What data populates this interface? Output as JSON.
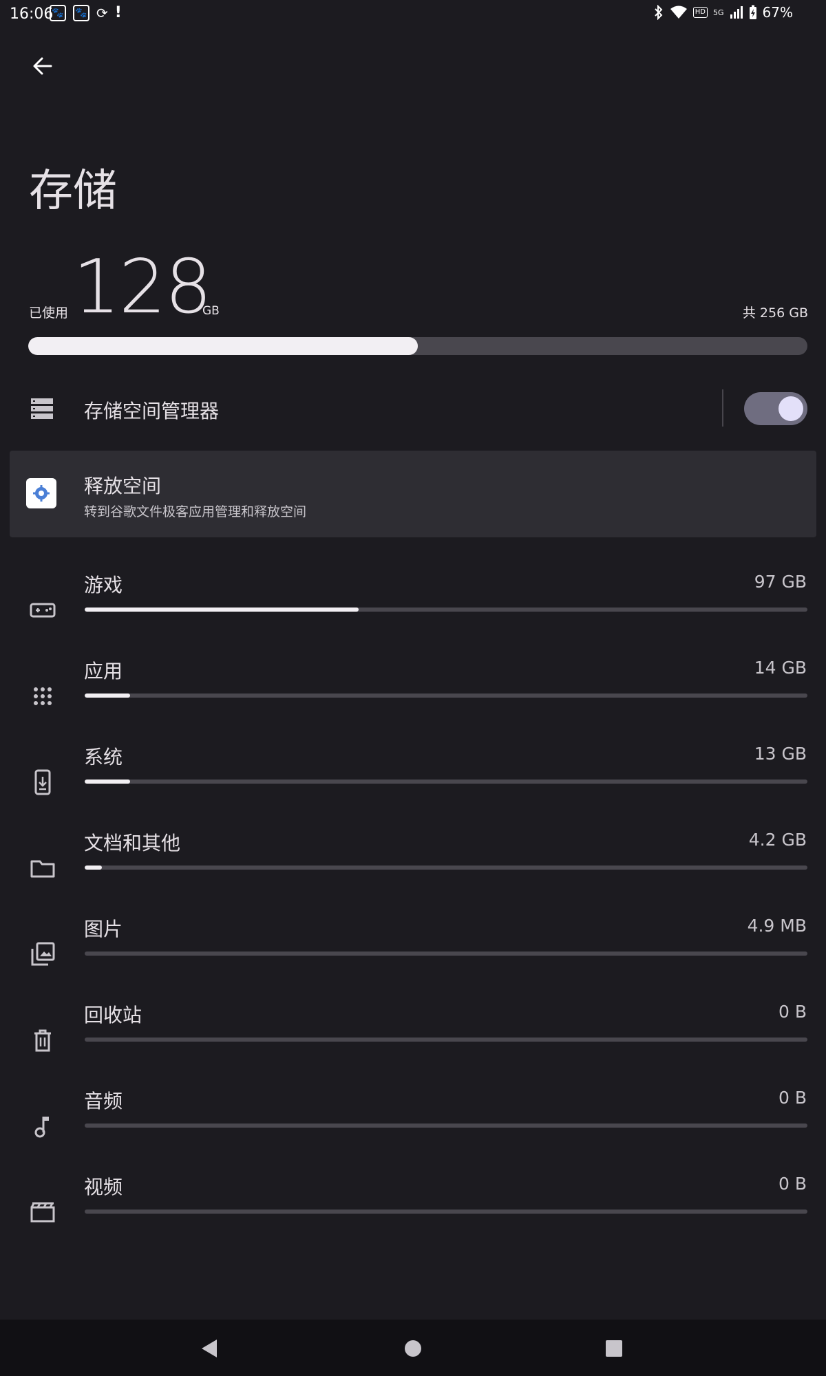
{
  "status_bar": {
    "time": "16:06",
    "battery": "67%",
    "hd": "HD",
    "network": "5G"
  },
  "header": {
    "title": "存储"
  },
  "summary": {
    "used_label": "已使用",
    "used_value": "128",
    "used_unit": "GB",
    "total_label": "共 256 GB",
    "used_fraction": 0.5
  },
  "storage_manager": {
    "label": "存储空间管理器",
    "enabled": true
  },
  "free_up": {
    "title": "释放空间",
    "subtitle": "转到谷歌文件极客应用管理和释放空间"
  },
  "categories": [
    {
      "label": "游戏",
      "size": "97 GB",
      "icon": "gamepad-icon",
      "fraction": 0.379
    },
    {
      "label": "应用",
      "size": "14 GB",
      "icon": "apps-grid-icon",
      "fraction": 0.063
    },
    {
      "label": "系统",
      "size": "13 GB",
      "icon": "system-update-icon",
      "fraction": 0.063
    },
    {
      "label": "文档和其他",
      "size": "4.2 GB",
      "icon": "folder-icon",
      "fraction": 0.024
    },
    {
      "label": "图片",
      "size": "4.9 MB",
      "icon": "photo-library-icon",
      "fraction": 0
    },
    {
      "label": "回收站",
      "size": "0 B",
      "icon": "trash-icon",
      "fraction": 0
    },
    {
      "label": "音频",
      "size": "0 B",
      "icon": "music-note-icon",
      "fraction": 0
    },
    {
      "label": "视频",
      "size": "0 B",
      "icon": "movie-icon",
      "fraction": 0
    }
  ],
  "colors": {
    "background": "#1c1b20",
    "bar_fill": "#f2eff3",
    "bar_track": "#49474e",
    "toggle_track": "#6f6d80"
  }
}
